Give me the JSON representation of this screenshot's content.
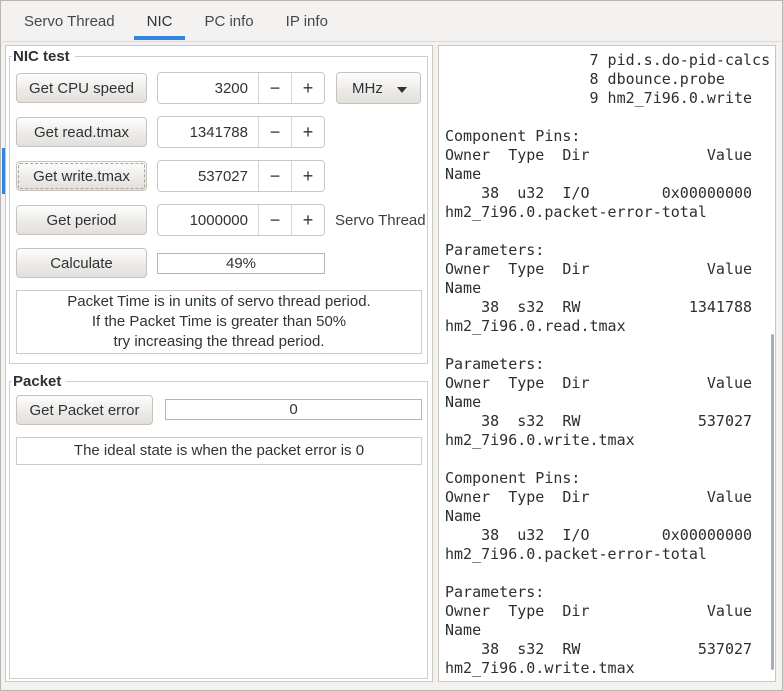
{
  "tabs": [
    {
      "label": "Servo Thread"
    },
    {
      "label": "NIC"
    },
    {
      "label": "PC info"
    },
    {
      "label": "IP info"
    }
  ],
  "controls": {
    "minus_glyph": "−",
    "plus_glyph": "+"
  },
  "nic_test": {
    "title": "NIC test",
    "rows": [
      {
        "button": "Get CPU speed",
        "value": "3200"
      },
      {
        "button": "Get read.tmax",
        "value": "1341788"
      },
      {
        "button": "Get write.tmax",
        "value": "537027"
      },
      {
        "button": "Get period",
        "value": "1000000"
      }
    ],
    "unit_selected": "MHz",
    "period_label": "Servo Thread",
    "calculate_button": "Calculate",
    "progress_value": "49%",
    "note_line1": "Packet Time is in units of servo thread period.",
    "note_line2": "If the Packet Time is greater than 50%",
    "note_line3": "try increasing the thread period."
  },
  "packet": {
    "title": "Packet",
    "button": "Get Packet error",
    "value": "0",
    "note": "The ideal state is when the packet error is 0"
  },
  "output": {
    "text": "                7 pid.s.do-pid-calcs\n                8 dbounce.probe\n                9 hm2_7i96.0.write\n\nComponent Pins:\nOwner  Type  Dir             Value\nName\n    38  u32  I/O        0x00000000\nhm2_7i96.0.packet-error-total\n\nParameters:\nOwner  Type  Dir             Value\nName\n    38  s32  RW            1341788\nhm2_7i96.0.read.tmax\n\nParameters:\nOwner  Type  Dir             Value\nName\n    38  s32  RW             537027\nhm2_7i96.0.write.tmax\n\nComponent Pins:\nOwner  Type  Dir             Value\nName\n    38  u32  I/O        0x00000000\nhm2_7i96.0.packet-error-total\n\nParameters:\nOwner  Type  Dir             Value\nName\n    38  s32  RW             537027\nhm2_7i96.0.write.tmax"
  },
  "colors": {
    "accent": "#3584e4",
    "pane_background": "#ffffff",
    "window_background": "#f3f2f0",
    "border": "#cdc7c2"
  }
}
